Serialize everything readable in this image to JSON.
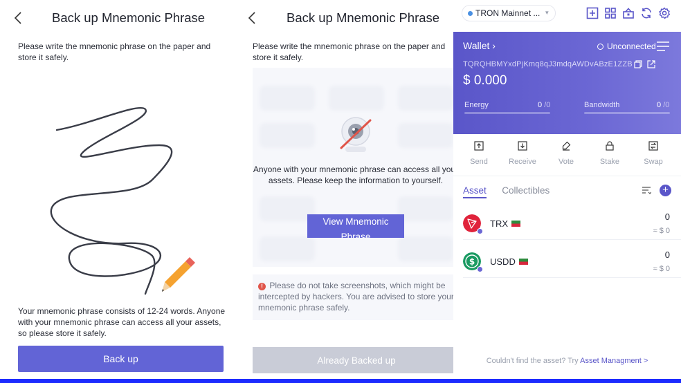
{
  "panel1": {
    "title": "Back up Mnemonic Phrase",
    "intro": "Please write the mnemonic phrase on the paper and store it safely.",
    "note": "Your mnemonic phrase consists of 12-24 words. Anyone with your mnemonic phrase can access all your assets, so please store it safely.",
    "button": "Back up"
  },
  "panel2": {
    "title": "Back up Mnemonic Phrase",
    "intro": "Please write the mnemonic phrase on the paper and store it safely.",
    "warning": "Anyone with your mnemonic phrase can access all your assets. Please keep the information to yourself.",
    "view_button": "View Mnemonic Phrase",
    "notice": "Please do not take screenshots, which might be intercepted by hackers. You are advised to store your mnemonic phrase safely.",
    "done_button": "Already Backed up"
  },
  "panel3": {
    "network": "TRON Mainnet ...",
    "wallet_label": "Wallet",
    "status": "Unconnected",
    "address": "TQRQHBMYxdPjKmq8qJ3mdqAWDvABzE1ZZB",
    "balance": "$ 0.000",
    "energy": {
      "label": "Energy",
      "used": "0",
      "total": "/0"
    },
    "bandwidth": {
      "label": "Bandwidth",
      "used": "0",
      "total": "/0"
    },
    "actions": [
      "Send",
      "Receive",
      "Vote",
      "Stake",
      "Swap"
    ],
    "tabs": {
      "asset": "Asset",
      "collectibles": "Collectibles"
    },
    "assets": [
      {
        "symbol": "TRX",
        "amount": "0",
        "fiat": "≈ $ 0"
      },
      {
        "symbol": "USDD",
        "amount": "0",
        "fiat": "≈ $ 0"
      }
    ],
    "footer_text": "Couldn't find the asset? Try",
    "footer_link": "Asset Managment >"
  },
  "colors": {
    "accent": "#6264d6",
    "wallet_card": "#5a56c9",
    "disabled": "#c9ccd7",
    "trx_red": "#e0233b",
    "usdd_green": "#1a9a62"
  }
}
